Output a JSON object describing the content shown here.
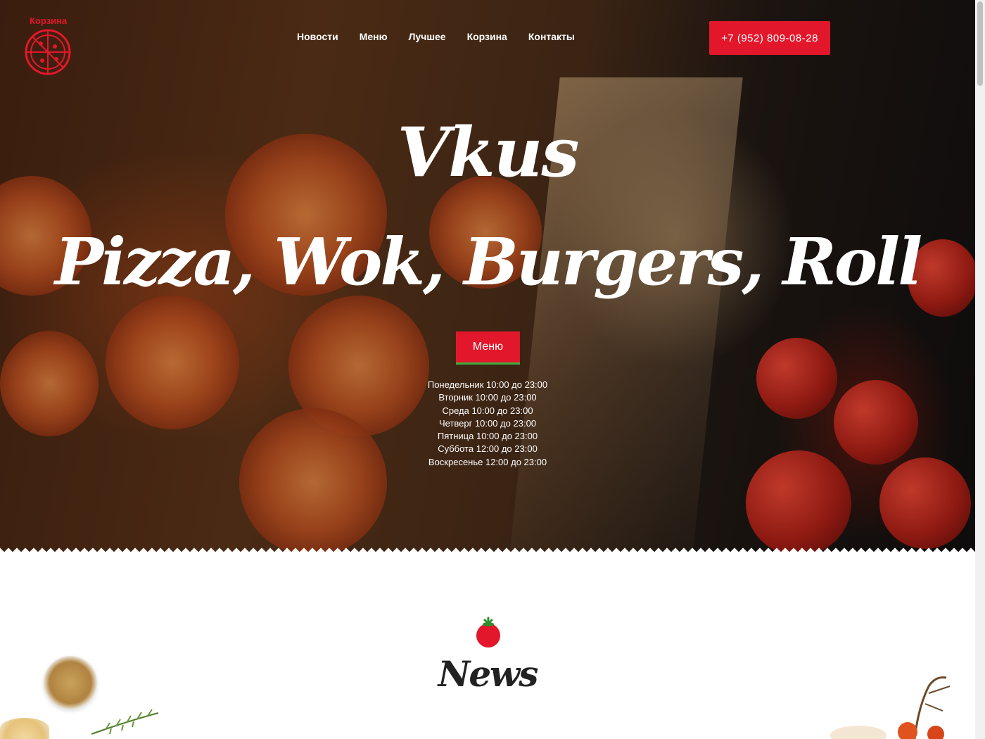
{
  "header": {
    "logo_label": "Корзина",
    "nav": [
      {
        "label": "Новости"
      },
      {
        "label": "Меню"
      },
      {
        "label": "Лучшее"
      },
      {
        "label": "Корзина"
      },
      {
        "label": "Контакты"
      }
    ],
    "phone": "+7 (952) 809-08-28"
  },
  "hero": {
    "title": "Vkus",
    "subtitle": "Pizza, Wok, Burgers, Roll",
    "menu_button": "Меню",
    "hours": [
      "Понедельник 10:00 до 23:00",
      "Вторник 10:00 до 23:00",
      "Среда 10:00 до 23:00",
      "Четверг 10:00 до 23:00",
      "Пятница 10:00 до 23:00",
      "Суббота 12:00 до 23:00",
      "Воскресенье 12:00 до 23:00"
    ]
  },
  "news": {
    "title": "News"
  },
  "colors": {
    "accent": "#e3172b",
    "menu_underline": "#3fae3f"
  },
  "icons": [
    "pizza-logo-icon",
    "tomato-icon"
  ]
}
